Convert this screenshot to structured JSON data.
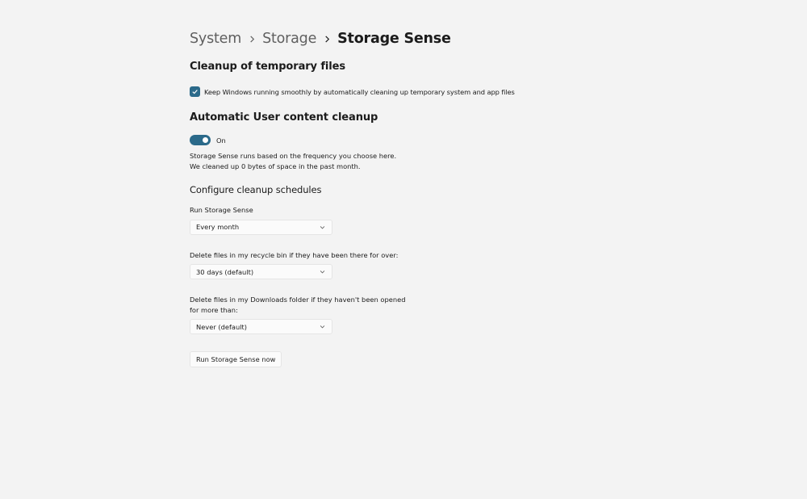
{
  "breadcrumb": {
    "items": [
      "System",
      "Storage"
    ],
    "current": "Storage Sense"
  },
  "temp_cleanup": {
    "title": "Cleanup of temporary files",
    "checkbox_label": "Keep Windows running smoothly by automatically cleaning up temporary system and app files",
    "checked": true
  },
  "user_cleanup": {
    "title": "Automatic User content cleanup",
    "toggle_label": "On",
    "toggle_on": true,
    "description": "Storage Sense runs based on the frequency you choose here. We cleaned up 0 bytes of space in the past month."
  },
  "schedules": {
    "heading": "Configure cleanup schedules",
    "run_label": "Run Storage Sense",
    "run_value": "Every month",
    "recycle_label": "Delete files in my recycle bin if they have been there for over:",
    "recycle_value": "30 days (default)",
    "downloads_label": "Delete files in my Downloads folder if they haven't been opened for more than:",
    "downloads_value": "Never (default)"
  },
  "actions": {
    "run_now_label": "Run Storage Sense now"
  },
  "colors": {
    "accent": "#2b6a8a",
    "background": "#f3f3f3",
    "control_bg": "#fbfbfb"
  },
  "icons": {
    "breadcrumb_separator": "chevron-right-icon",
    "checkbox": "checkmark-icon",
    "dropdown": "chevron-down-icon"
  }
}
